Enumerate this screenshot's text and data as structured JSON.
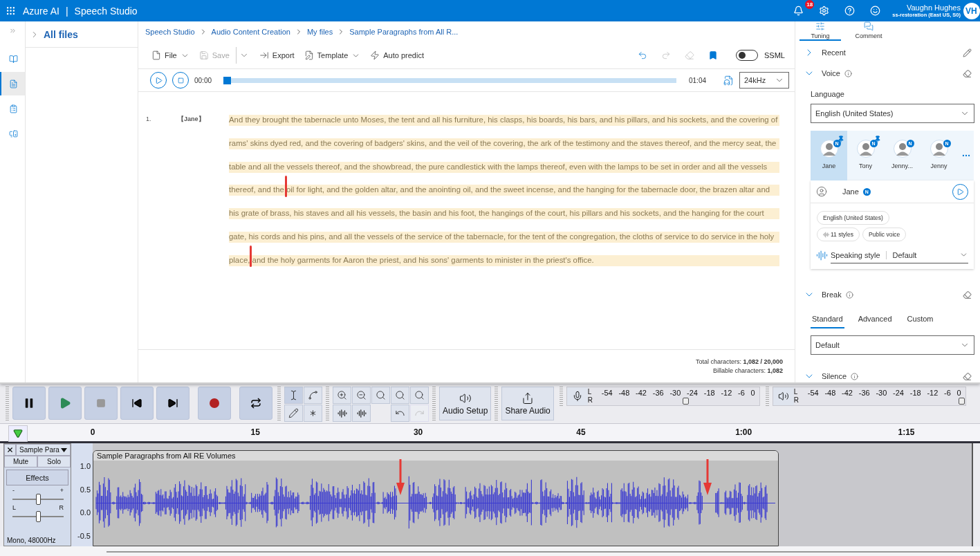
{
  "top_bar": {
    "product": "Azure AI",
    "separator": "|",
    "app": "Speech Studio",
    "notifications": "18",
    "user_name": "Vaughn Hughes",
    "user_resource": "ss-restoration (East US, S0)",
    "avatar": "VH"
  },
  "nav": [
    {
      "selected": false
    },
    {
      "selected": true
    },
    {
      "selected": false
    },
    {
      "selected": false
    }
  ],
  "files_panel": {
    "title": "All files"
  },
  "breadcrumb": [
    "Speech Studio",
    "Audio Content Creation",
    "My files",
    "Sample Paragraphs from All R..."
  ],
  "toolbar": [
    {
      "kind": "menu",
      "label": "File",
      "disabled": false
    },
    {
      "kind": "split",
      "label": "Save",
      "disabled": true
    },
    {
      "kind": "button",
      "label": "Export",
      "disabled": false
    },
    {
      "kind": "menu",
      "label": "Template",
      "disabled": false
    },
    {
      "kind": "button",
      "label": "Auto predict",
      "disabled": false
    }
  ],
  "history": [
    {
      "disabled": false
    },
    {
      "disabled": true
    },
    {
      "disabled": true
    }
  ],
  "ssml": {
    "label": "SSML",
    "on": false
  },
  "player": {
    "current": "00:00",
    "total": "01:04",
    "level": 0,
    "sample_rate": "24kHz"
  },
  "paragraphs": [
    {
      "number": "1.",
      "speaker": "【Jane】",
      "text": "And they brought the tabernacle unto Moses, the tent and all his furniture, his clasps, his boards, his bars, and his pillars, and his sockets, and the covering of rams' skins dyed red, and the covering of badgers' skins, and the veil of the covering, the ark of the testimony and the staves thereof, and the mercy seat, the table and all the vessels thereof, and the showbread, the pure candlestick with the lamps thereof, even with the lamps to be set in order and all the vessels thereof, and the oil for light, and the golden altar, and the anointing oil, and the sweet incense, and the hanging for the tabernacle door, the brazen altar and his grate of brass, his staves and all his vessels, the basin and his foot, the hangings of the court, his pillars and his sockets, and the hanging for the court gate, his cords and his pins, and all the vessels of the service of the tabernacle, for the tent of the congregation, the cloths of service to do service in the holy place, and the holy garments for Aaron the priest, and his sons' garments to minister in the priest's office."
    }
  ],
  "footer": [
    {
      "label": "Total characters:",
      "value": "1,082 / 20,000"
    },
    {
      "label": "Billable characters:",
      "value": "1,082"
    }
  ],
  "side_tabs": [
    {
      "label": "Tuning",
      "selected": true
    },
    {
      "label": "Comment",
      "selected": false
    }
  ],
  "sections": [
    {
      "kind": "recent",
      "title": "Recent",
      "expanded": false
    },
    {
      "kind": "voice",
      "title": "Voice",
      "expanded": true,
      "language_label": "Language",
      "language": "English (United States)",
      "voices": [
        {
          "name": "Jane",
          "badge": "N",
          "pinned": true,
          "selected": true
        },
        {
          "name": "Tony",
          "badge": "N",
          "pinned": true,
          "selected": false
        },
        {
          "name": "Jenny...",
          "badge": "N",
          "pinned": false,
          "selected": false
        },
        {
          "name": "Jenny",
          "badge": "N",
          "pinned": false,
          "selected": false
        }
      ],
      "detail": {
        "name": "Jane",
        "badge": "N",
        "tags": [
          "English (United States)",
          "11 styles",
          "Public voice"
        ],
        "style_label": "Speaking style",
        "style": "Default"
      }
    },
    {
      "kind": "break",
      "title": "Break",
      "expanded": true,
      "tabs": [
        {
          "label": "Standard",
          "selected": true
        },
        {
          "label": "Advanced",
          "selected": false
        },
        {
          "label": "Custom",
          "selected": false
        }
      ],
      "value": "Default"
    },
    {
      "kind": "silence",
      "title": "Silence",
      "expanded": true
    }
  ],
  "audacity": {
    "tools": [
      {
        "selected": true
      },
      {
        "selected": false
      },
      {
        "selected": false
      },
      {
        "selected": false
      }
    ],
    "history": [
      {
        "disabled": false
      },
      {
        "disabled": true
      }
    ],
    "audio_setup": "Audio Setup",
    "share_audio": "Share Audio",
    "meters": [
      {
        "kind": "record",
        "channels": [
          "L",
          "R"
        ],
        "scale": [
          "-54",
          "-48",
          "-42",
          "-36",
          "-30",
          "-24",
          "-18",
          "-12",
          "-6",
          "0"
        ]
      },
      {
        "kind": "playback",
        "channels": [
          "L",
          "R"
        ],
        "scale": [
          "-54",
          "-48",
          "-42",
          "-36",
          "-30",
          "-24",
          "-18",
          "-12",
          "-6",
          "0"
        ]
      }
    ],
    "ruler": [
      "0",
      "15",
      "30",
      "45",
      "1:00",
      "1:15"
    ],
    "track": {
      "name": "Sample Para",
      "mute": "Mute",
      "solo": "Solo",
      "effects": "Effects",
      "gain": {
        "min": "-",
        "max": "+",
        "level": 0.5
      },
      "pan": {
        "min": "L",
        "max": "R",
        "level": 0.5
      },
      "format": "Mono, 48000Hz",
      "axis": [
        "1.0",
        "0.5",
        "0.0",
        "-0.5"
      ],
      "clip": "Sample Paragraphs from All RE Volumes"
    }
  }
}
